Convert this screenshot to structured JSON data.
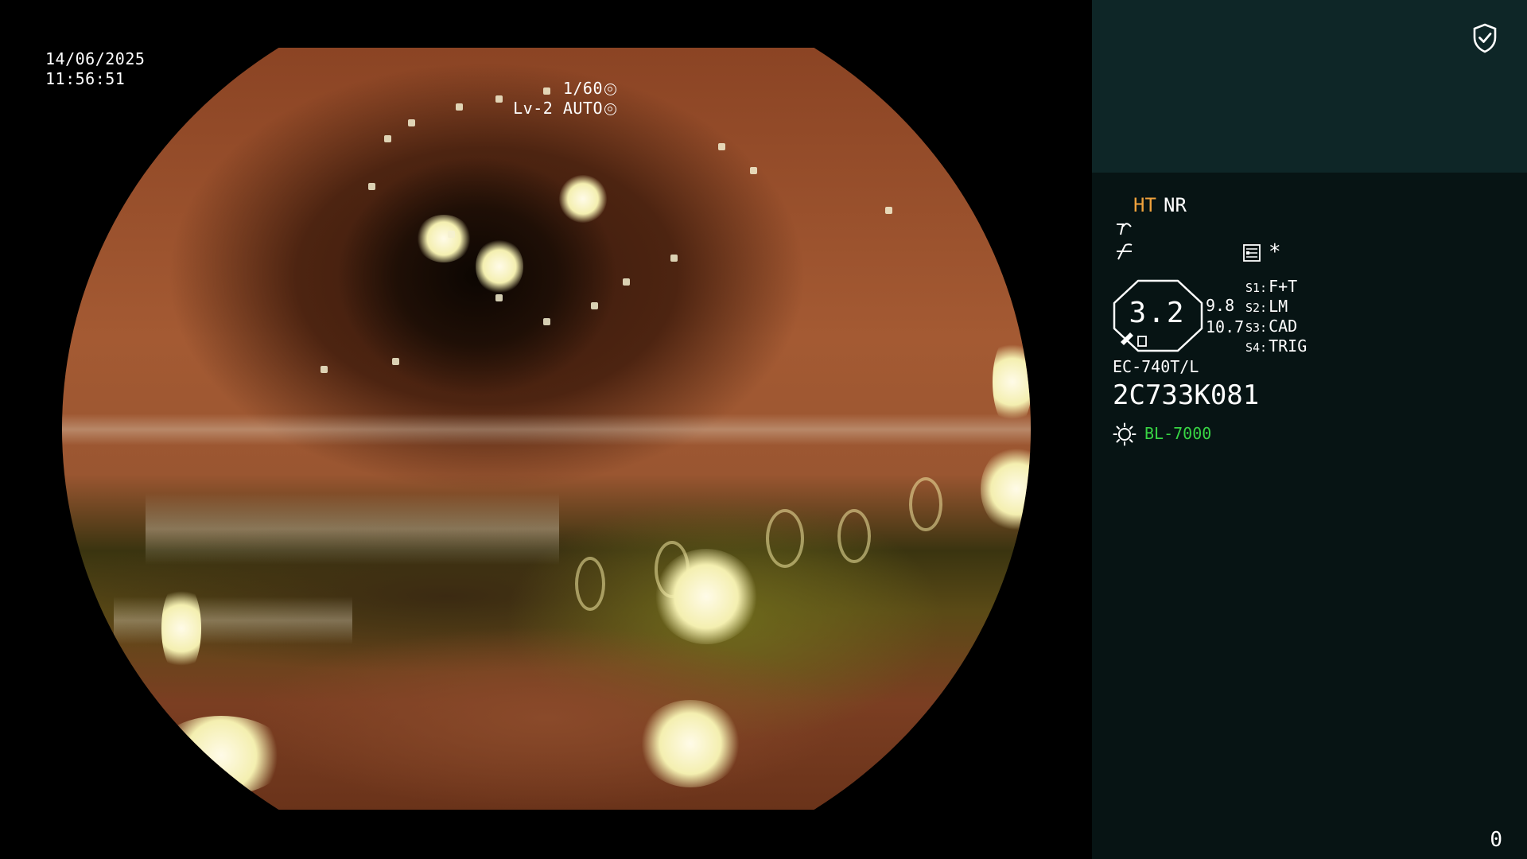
{
  "overlay": {
    "date": "14/06/2025",
    "time": "11:56:51",
    "shutter": "1/60",
    "shutter_icon": "aperture-icon",
    "level": "Lv-2 AUTO",
    "level_icon": "iris-icon"
  },
  "panel": {
    "shield_icon": "shield-check-icon",
    "mode_ht": "HT",
    "mode_nr": "NR",
    "colors": {
      "ht": "#f0a23c",
      "light_model": "#38d444",
      "panel_top_bg": "#0e2627",
      "panel_bg": "#071414"
    },
    "zoom_value": "3.2",
    "value_1": "9.8",
    "value_2": "10.7",
    "menu_icon": "menu-icon",
    "asterisk": "*",
    "scope_switches": [
      {
        "key": "S1:",
        "value": "F+T"
      },
      {
        "key": "S2:",
        "value": "LM"
      },
      {
        "key": "S3:",
        "value": "CAD"
      },
      {
        "key": "S4:",
        "value": "TRIG"
      }
    ],
    "scope_model": "EC-740T/L",
    "serial_number": "2C733K081",
    "light_icon": "sun-icon",
    "light_source_model": "BL-7000",
    "counter": "0"
  }
}
